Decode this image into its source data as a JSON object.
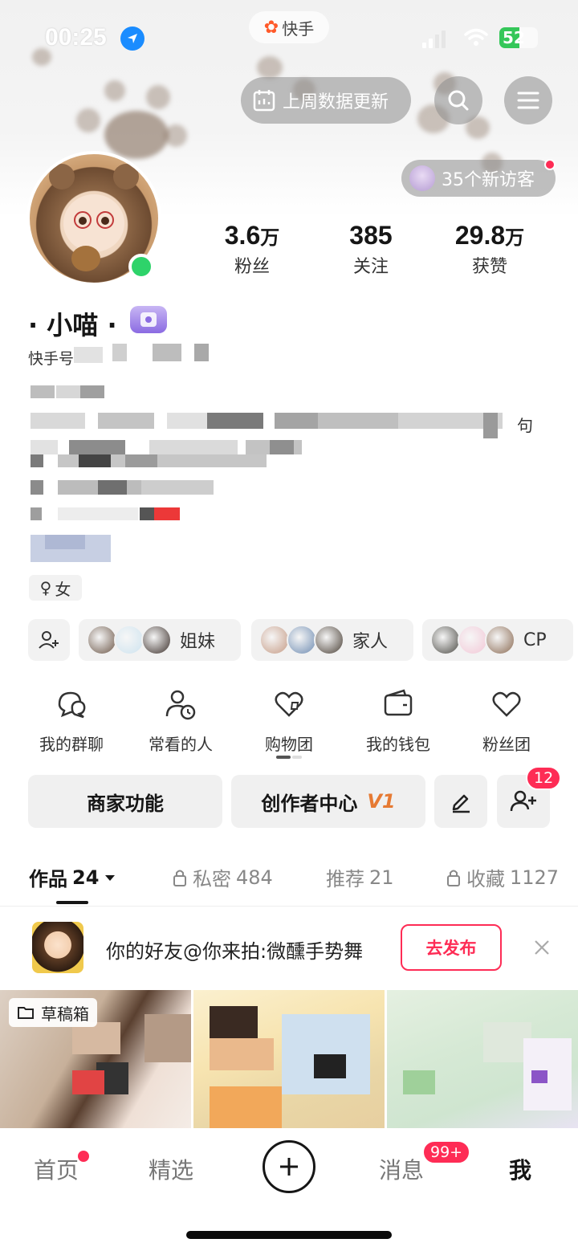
{
  "status_bar": {
    "time": "00:25",
    "battery": "52",
    "battery_fraction": 0.52,
    "app_label": "快手"
  },
  "header": {
    "weekly_data_label": "上周数据更新",
    "visitors_label": "35个新访客"
  },
  "profile": {
    "username": "· 小喵 ·",
    "id_label": "快手号",
    "bio_trailing_char": "句",
    "gender_label": "女",
    "gender_icon": "♀",
    "stats": [
      {
        "value": "3.6",
        "unit": "万",
        "label": "粉丝"
      },
      {
        "value": "385",
        "unit": "",
        "label": "关注"
      },
      {
        "value": "29.8",
        "unit": "万",
        "label": "获赞"
      }
    ]
  },
  "relations": [
    {
      "label": "姐妹",
      "colors": [
        "#6b5647",
        "#cde3ef",
        "#3b2f2a"
      ]
    },
    {
      "label": "家人",
      "colors": [
        "#c59a84",
        "#6d8bb1",
        "#4a4036"
      ]
    },
    {
      "label": "CP",
      "colors": [
        "#4b4a44",
        "#f2c7d6",
        "#8a6a52"
      ]
    }
  ],
  "quick_actions": [
    {
      "label": "我的群聊",
      "icon": "group-chat-icon"
    },
    {
      "label": "常看的人",
      "icon": "frequent-people-icon"
    },
    {
      "label": "购物团",
      "icon": "shopping-group-icon"
    },
    {
      "label": "我的钱包",
      "icon": "wallet-icon"
    },
    {
      "label": "粉丝团",
      "icon": "fan-club-icon"
    }
  ],
  "actions": {
    "merchant_label": "商家功能",
    "creator_label": "创作者中心",
    "creator_level": "V1",
    "friend_requests": "12"
  },
  "tabs": [
    {
      "label": "作品",
      "count": "24",
      "active": true,
      "locked": false
    },
    {
      "label": "私密",
      "count": "484",
      "active": false,
      "locked": true
    },
    {
      "label": "推荐",
      "count": "21",
      "active": false,
      "locked": false
    },
    {
      "label": "收藏",
      "count": "1127",
      "active": false,
      "locked": true
    }
  ],
  "invite": {
    "text": "你的好友@你来拍:微醺手势舞",
    "button_label": "去发布"
  },
  "grid": {
    "draft_label": "草稿箱"
  },
  "nav": {
    "home": "首页",
    "featured": "精选",
    "messages": "消息",
    "messages_badge": "99+",
    "me": "我"
  },
  "colors": {
    "accent": "#fe2c55",
    "online": "#2ed36a",
    "creator_level": "#e67a33"
  }
}
